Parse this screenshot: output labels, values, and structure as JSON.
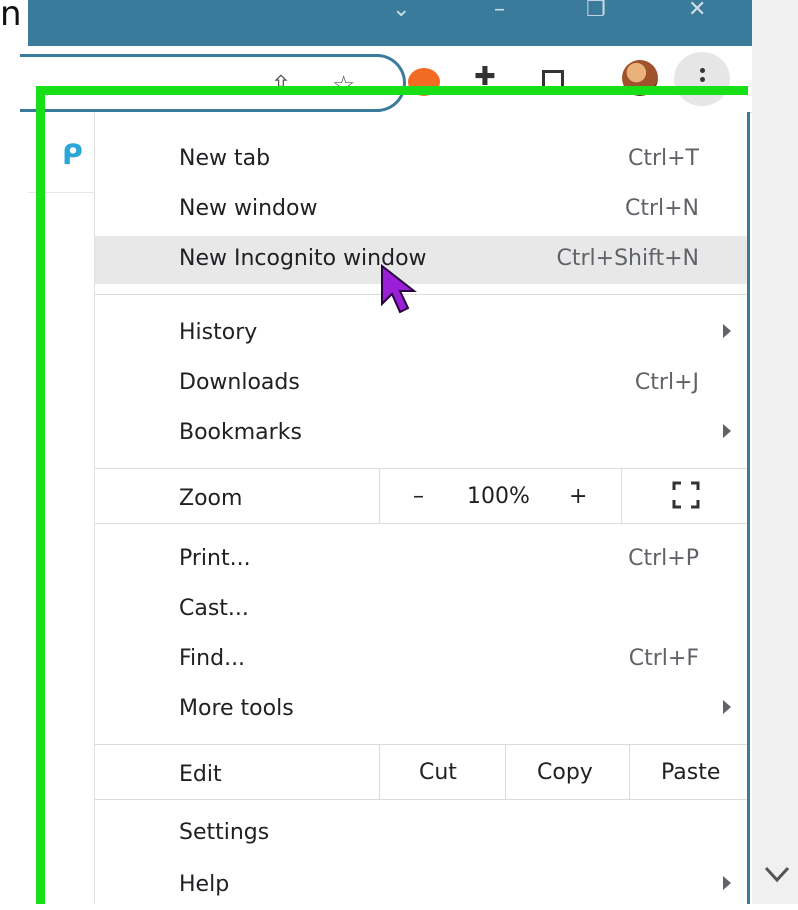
{
  "corner": {
    "letter": "n"
  },
  "colors": {
    "titlebar": "#3a7a9a",
    "highlight_border": "#18e018",
    "hover": "#e8e8e9"
  },
  "titlebar": {
    "icons": [
      "chevron-down-icon",
      "minimize-icon",
      "restore-icon",
      "close-icon"
    ]
  },
  "toolbar": {
    "icons": [
      "share-icon",
      "bookmark-star-icon",
      "extension-orange-icon",
      "puzzle-icon",
      "side-panel-icon",
      "profile-avatar",
      "kebab-menu-icon"
    ]
  },
  "menu": {
    "group1": [
      {
        "label": "New tab",
        "shortcut": "Ctrl+T"
      },
      {
        "label": "New window",
        "shortcut": "Ctrl+N"
      },
      {
        "label": "New Incognito window",
        "shortcut": "Ctrl+Shift+N"
      }
    ],
    "group2": [
      {
        "label": "History"
      },
      {
        "label": "Downloads",
        "shortcut": "Ctrl+J"
      },
      {
        "label": "Bookmarks"
      }
    ],
    "zoom": {
      "label": "Zoom",
      "minus": "–",
      "value": "100%",
      "plus": "+"
    },
    "group3": [
      {
        "label": "Print...",
        "shortcut": "Ctrl+P"
      },
      {
        "label": "Cast..."
      },
      {
        "label": "Find...",
        "shortcut": "Ctrl+F"
      },
      {
        "label": "More tools"
      }
    ],
    "edit": {
      "label": "Edit",
      "cut": "Cut",
      "copy": "Copy",
      "paste": "Paste"
    },
    "group4": [
      {
        "label": "Settings"
      },
      {
        "label": "Help"
      }
    ]
  }
}
